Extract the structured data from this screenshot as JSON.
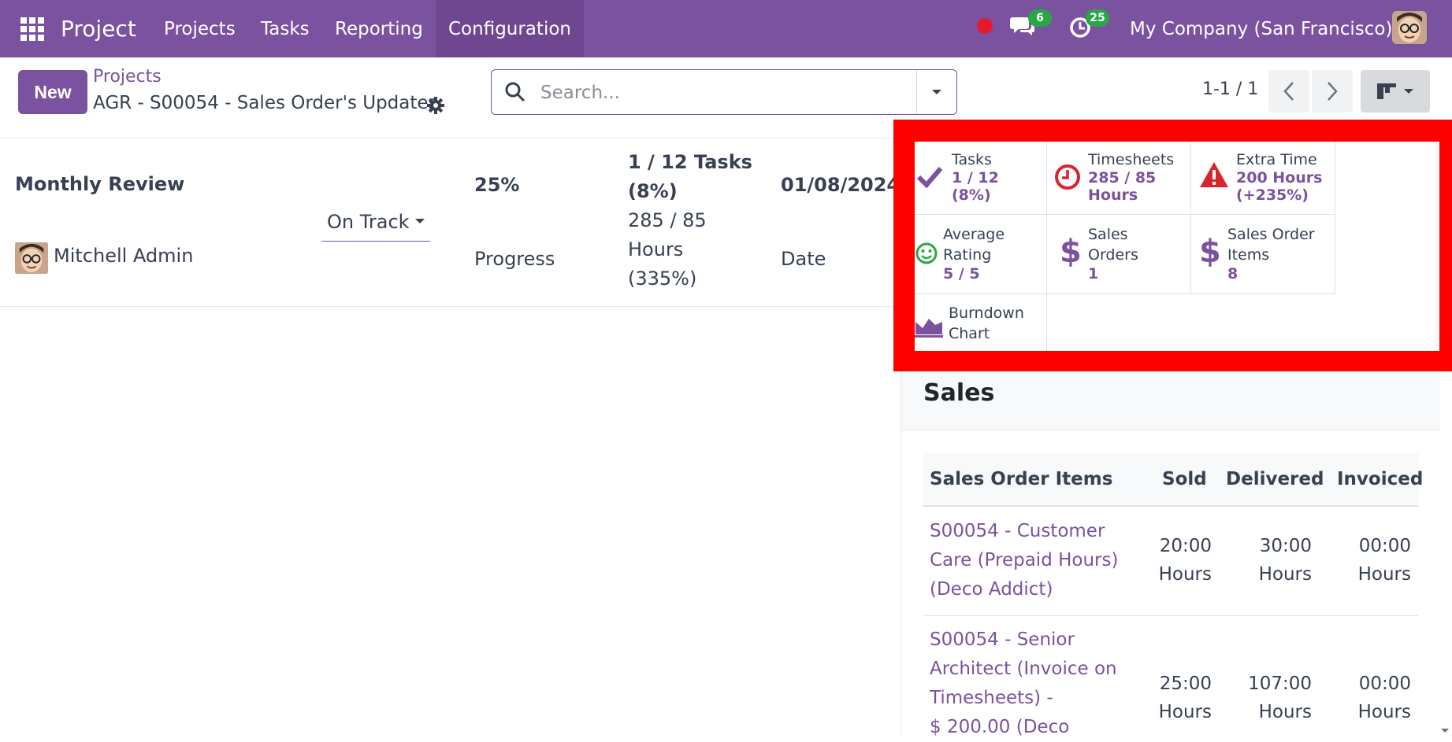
{
  "navbar": {
    "app_name": "Project",
    "menu": [
      "Projects",
      "Tasks",
      "Reporting",
      "Configuration"
    ],
    "active_menu": "Configuration",
    "messages_count": "6",
    "activities_count": "25",
    "company": "My Company (San Francisco)",
    "bg_color": "#7b529f"
  },
  "control_panel": {
    "new_button": "New",
    "breadcrumb_parent": "Projects",
    "breadcrumb_current": "AGR - S00054 - Sales Order's Updates",
    "search_placeholder": "Search...",
    "pager": "1-1 / 1"
  },
  "milestone": {
    "name": "Monthly Review",
    "user": "Mitchell Admin",
    "status": "On Track",
    "progress_value": "25%",
    "progress_label": "Progress",
    "tasks_line1": "1 / 12 Tasks",
    "tasks_line2": "(8%)",
    "hours_line1": "285 / 85",
    "hours_line2": "Hours",
    "hours_line3": "(335%)",
    "date_value": "01/08/2024",
    "date_label": "Date"
  },
  "stat_buttons": [
    {
      "icon": "check-icon",
      "label_lines": [
        "Tasks"
      ],
      "value_lines": [
        "1 / 12",
        "(8%)"
      ]
    },
    {
      "icon": "clock-icon",
      "label_lines": [
        "Timesheets"
      ],
      "value_lines": [
        "285 / 85",
        "Hours"
      ]
    },
    {
      "icon": "warning-icon",
      "label_lines": [
        "Extra Time"
      ],
      "value_lines": [
        "200 Hours",
        "(+235%)"
      ]
    },
    {
      "icon": "smile-icon",
      "label_lines": [
        "Average",
        "Rating"
      ],
      "value_lines": [
        "5 / 5"
      ]
    },
    {
      "icon": "dollar-icon",
      "label_lines": [
        "Sales",
        "Orders"
      ],
      "value_lines": [
        "1"
      ]
    },
    {
      "icon": "dollar-icon",
      "label_lines": [
        "Sales Order",
        "Items"
      ],
      "value_lines": [
        "8"
      ]
    },
    {
      "icon": "area-chart-icon",
      "label_lines": [
        "Burndown",
        "Chart"
      ],
      "value_lines": []
    }
  ],
  "sales_panel": {
    "title": "Sales",
    "columns": [
      "Sales Order Items",
      "Sold",
      "Delivered",
      "Invoiced"
    ],
    "rows": [
      {
        "name_lines": [
          "S00054 - Customer",
          "Care (Prepaid Hours)",
          "(Deco Addict)"
        ],
        "sold": [
          "20:00",
          "Hours"
        ],
        "delivered": [
          "30:00",
          "Hours"
        ],
        "invoiced": [
          "00:00",
          "Hours"
        ]
      },
      {
        "name_lines": [
          "S00054 - Senior",
          "Architect (Invoice on",
          "Timesheets) -",
          "$ 200.00 (Deco"
        ],
        "sold": [
          "25:00",
          "Hours"
        ],
        "delivered": [
          "107:00",
          "Hours"
        ],
        "invoiced": [
          "00:00",
          "Hours"
        ]
      }
    ]
  }
}
